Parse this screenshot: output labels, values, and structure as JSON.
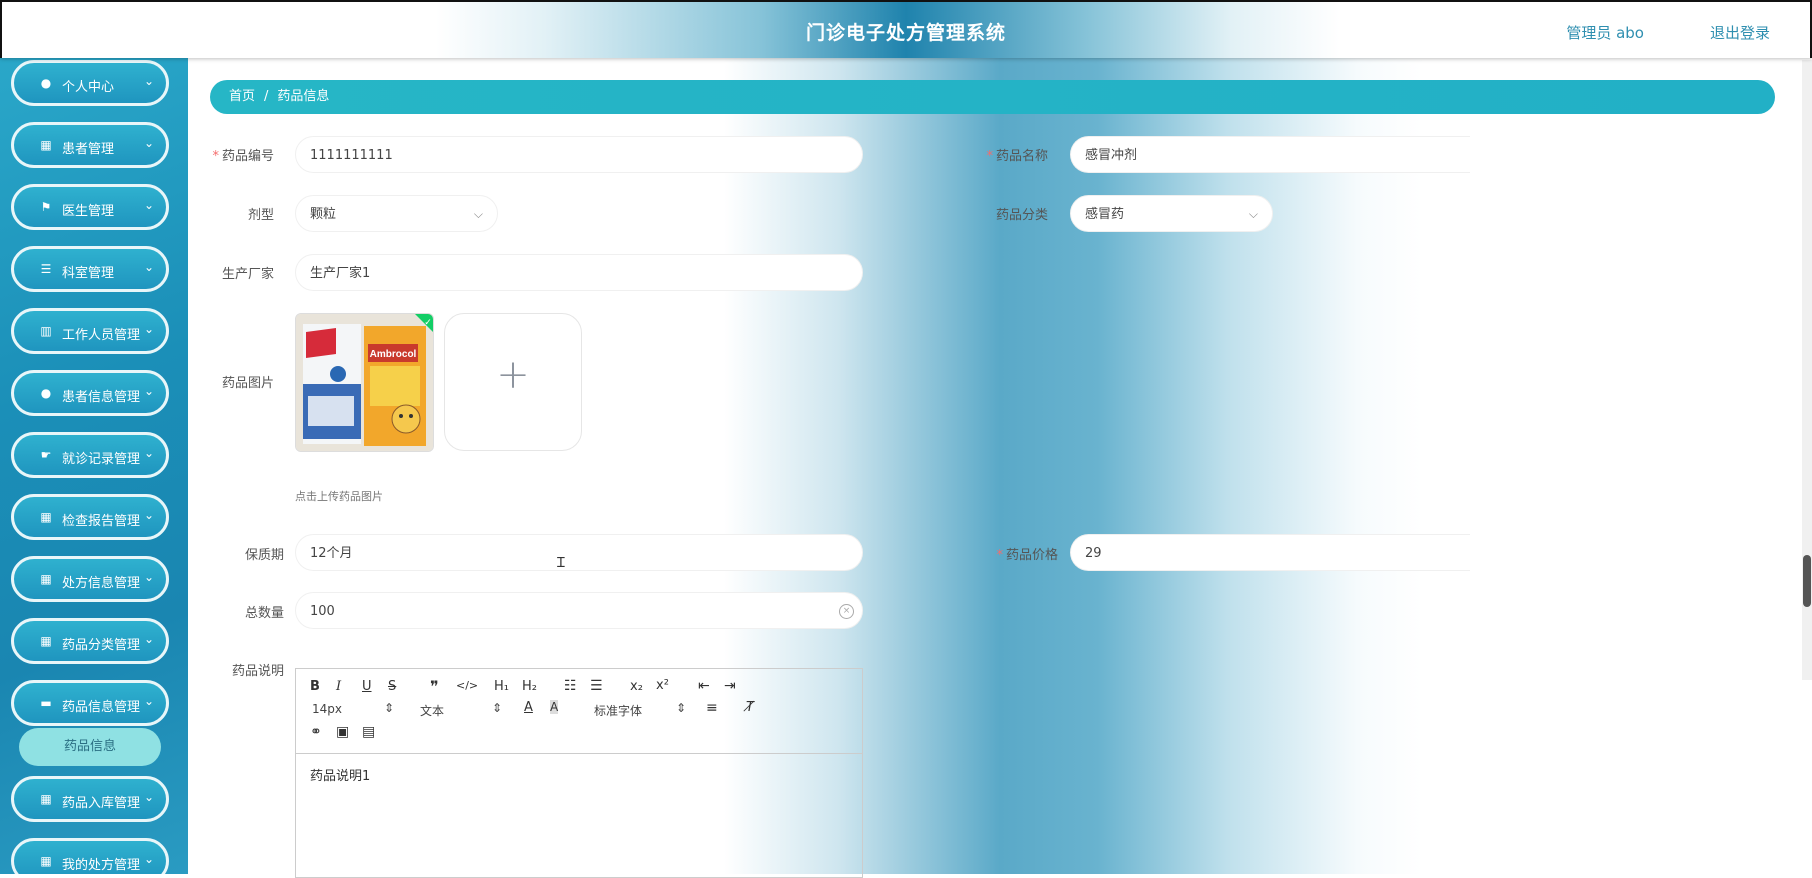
{
  "header": {
    "title": "门诊电子处方管理系统",
    "user": "管理员 abo",
    "logout": "退出登录"
  },
  "sidebar": {
    "items": [
      {
        "label": "个人中心",
        "icon": "user-icon"
      },
      {
        "label": "患者管理",
        "icon": "grid-icon"
      },
      {
        "label": "医生管理",
        "icon": "flag-icon"
      },
      {
        "label": "科室管理",
        "icon": "sliders-icon"
      },
      {
        "label": "工作人员管理",
        "icon": "building-icon"
      },
      {
        "label": "患者信息管理",
        "icon": "bulb-icon"
      },
      {
        "label": "就诊记录管理",
        "icon": "hand-icon"
      },
      {
        "label": "检查报告管理",
        "icon": "grid-icon"
      },
      {
        "label": "处方信息管理",
        "icon": "grid9-icon"
      },
      {
        "label": "药品分类管理",
        "icon": "grid-icon"
      },
      {
        "label": "药品信息管理",
        "icon": "ticket-icon"
      },
      {
        "label": "药品入库管理",
        "icon": "grid-icon"
      },
      {
        "label": "我的处方管理",
        "icon": "grid-icon"
      }
    ],
    "submenu": "药品信息"
  },
  "breadcrumb": {
    "home": "首页",
    "sep": "/",
    "current": "药品信息"
  },
  "form": {
    "code_label": "药品编号",
    "code_value": "1111111111",
    "name_label": "药品名称",
    "name_value": "感冒冲剂",
    "type_label": "剂型",
    "type_value": "颗粒",
    "category_label": "药品分类",
    "category_value": "感冒药",
    "maker_label": "生产厂家",
    "maker_value": "生产厂家1",
    "image_label": "药品图片",
    "image_hint": "点击上传药品图片",
    "shelf_label": "保质期",
    "shelf_value": "12个月",
    "price_label": "药品价格",
    "price_value": "29",
    "total_label": "总数量",
    "total_value": "100",
    "desc_label": "药品说明"
  },
  "editor": {
    "font_size": "14px",
    "block_type": "文本",
    "font_family": "标准字体",
    "content": "药品说明1"
  },
  "thumb_label": "Ambrocol"
}
